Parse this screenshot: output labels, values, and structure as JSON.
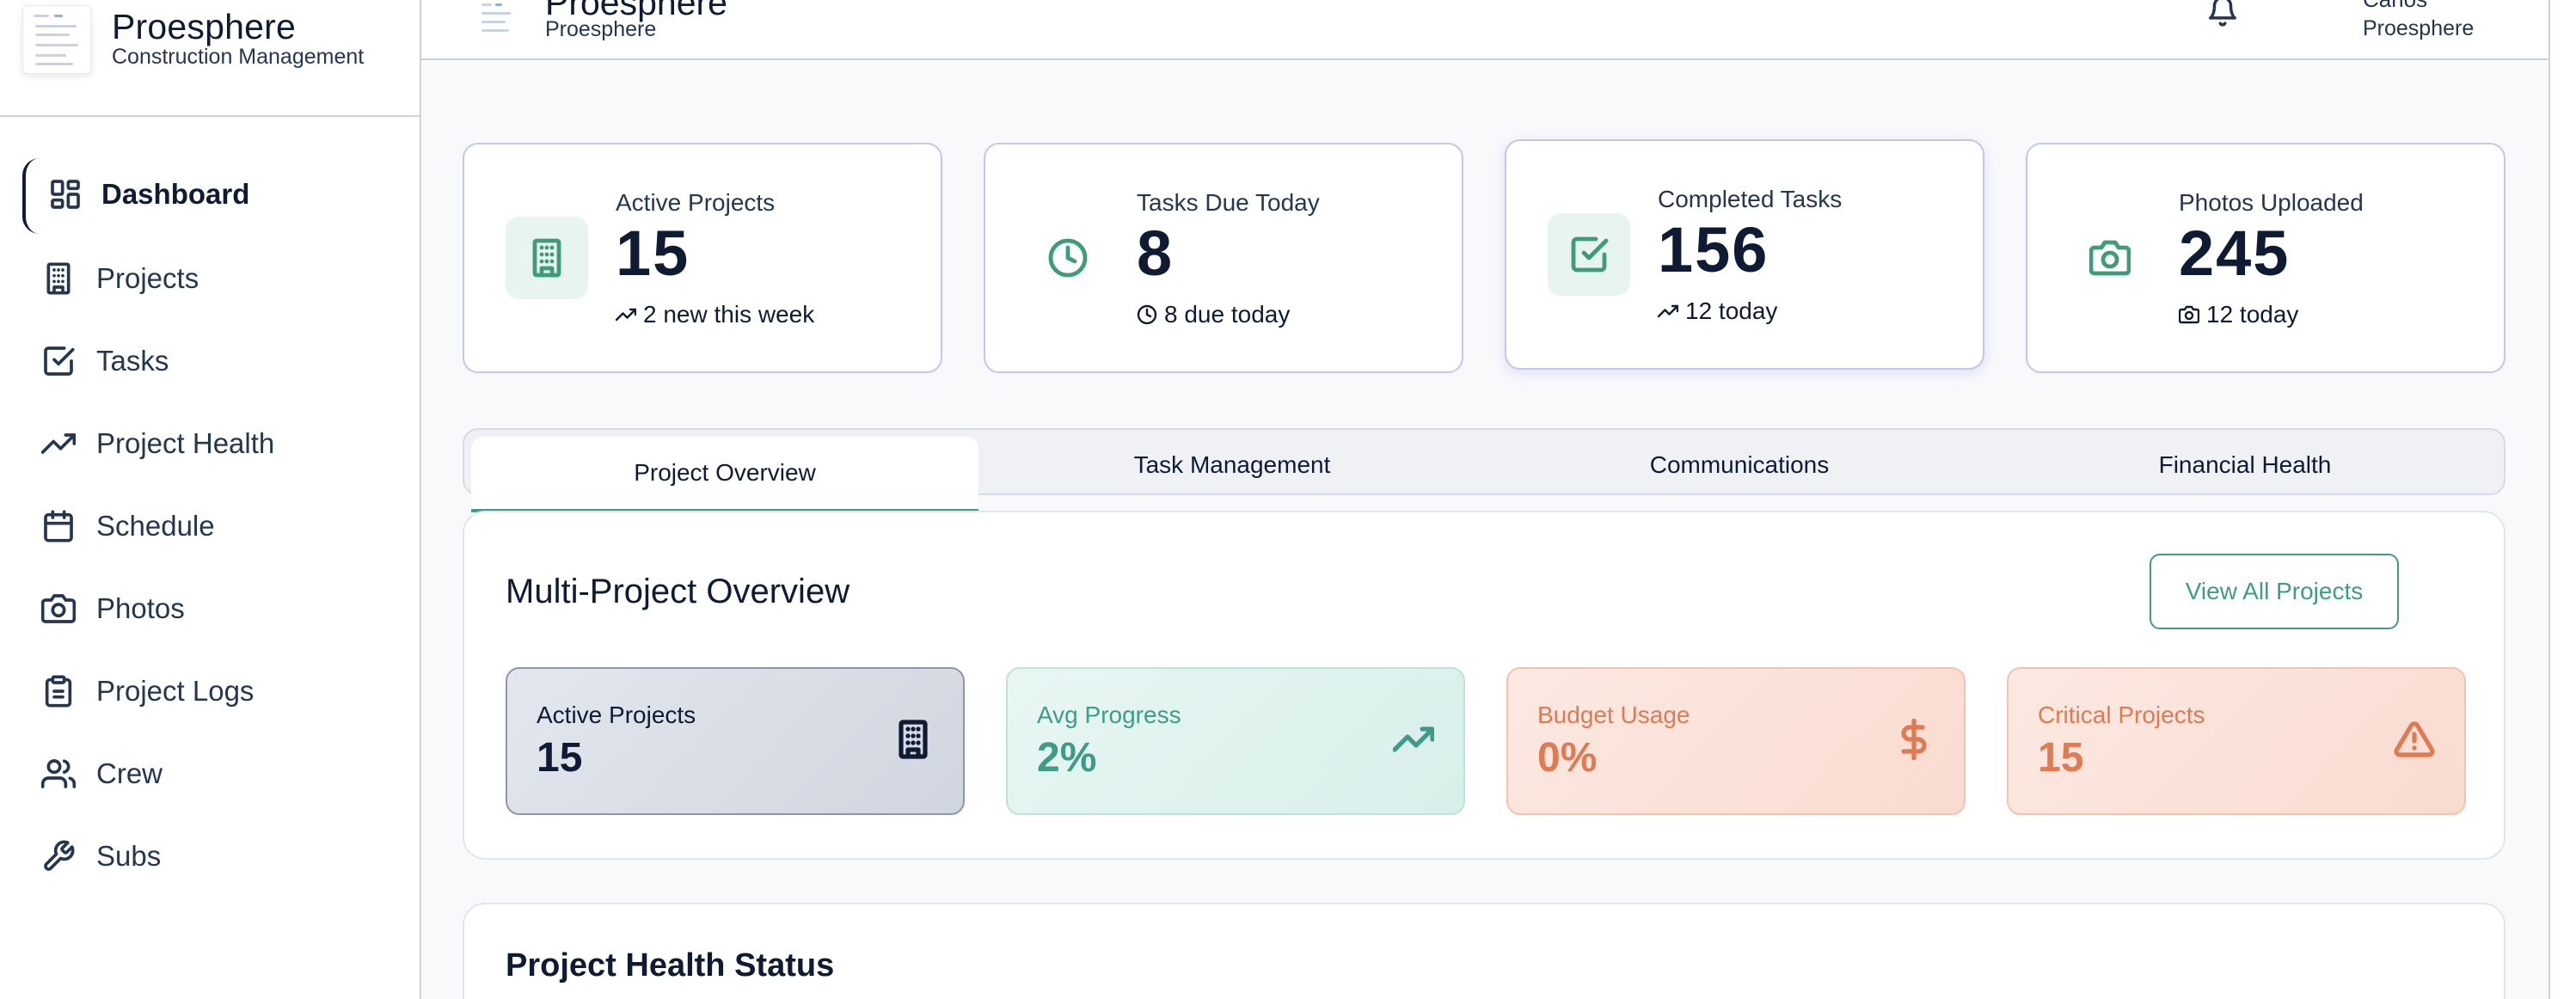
{
  "brand": {
    "title": "Proesphere",
    "subtitle": "Construction Management"
  },
  "sidebar": {
    "items": [
      {
        "label": "Dashboard",
        "icon": "dashboard-icon",
        "active": true
      },
      {
        "label": "Projects",
        "icon": "building-icon"
      },
      {
        "label": "Tasks",
        "icon": "checkbox-icon"
      },
      {
        "label": "Project Health",
        "icon": "trending-up-icon"
      },
      {
        "label": "Schedule",
        "icon": "calendar-icon"
      },
      {
        "label": "Photos",
        "icon": "camera-icon"
      },
      {
        "label": "Project Logs",
        "icon": "clipboard-icon"
      },
      {
        "label": "Crew",
        "icon": "users-icon"
      },
      {
        "label": "Subs",
        "icon": "wrench-icon"
      }
    ]
  },
  "header": {
    "title": "Proesphere",
    "subtitle": "Proesphere",
    "user_name": "Carlos",
    "user_org": "Proesphere"
  },
  "stats": [
    {
      "title": "Active Projects",
      "value": "15",
      "sub": "2 new this week",
      "icon": "building-icon",
      "sub_icon": "trending-up-icon"
    },
    {
      "title": "Tasks Due Today",
      "value": "8",
      "sub": "8 due today",
      "icon": "clock-icon",
      "sub_icon": "clock-icon"
    },
    {
      "title": "Completed Tasks",
      "value": "156",
      "sub": "12 today",
      "icon": "checkbox-icon",
      "sub_icon": "trending-up-icon"
    },
    {
      "title": "Photos Uploaded",
      "value": "245",
      "sub": "12 today",
      "icon": "camera-icon",
      "sub_icon": "camera-icon"
    }
  ],
  "tabs": [
    {
      "label": "Project Overview",
      "active": true
    },
    {
      "label": "Task Management"
    },
    {
      "label": "Communications"
    },
    {
      "label": "Financial Health"
    }
  ],
  "overview": {
    "title": "Multi-Project Overview",
    "view_all_label": "View All Projects",
    "cards": [
      {
        "label": "Active Projects",
        "value": "15",
        "icon": "building-icon"
      },
      {
        "label": "Avg Progress",
        "value": "2%",
        "icon": "trending-up-icon"
      },
      {
        "label": "Budget Usage",
        "value": "0%",
        "icon": "dollar-icon"
      },
      {
        "label": "Critical Projects",
        "value": "15",
        "icon": "alert-triangle-icon"
      }
    ]
  },
  "health": {
    "title": "Project Health Status"
  },
  "colors": {
    "accent": "#3f9b88",
    "warning": "#e07a52",
    "text": "#0f1b33",
    "card_border": "#c3c7ee"
  }
}
